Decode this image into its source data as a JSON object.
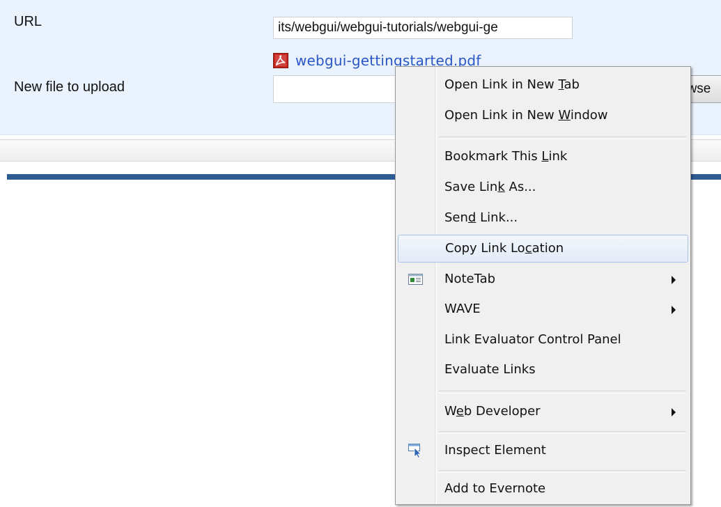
{
  "form": {
    "url_label": "URL",
    "url_value": "its/webgui/webgui-tutorials/webgui-ge",
    "file_link": "webgui-gettingstarted.pdf",
    "upload_label": "New file to upload",
    "browse_fragment": "Browse"
  },
  "menu": {
    "items": [
      {
        "pre": "Open Link in New ",
        "key": "T",
        "post": "ab"
      },
      {
        "pre": "Open Link in New ",
        "key": "W",
        "post": "indow"
      },
      {
        "pre": "Bookmark This ",
        "key": "L",
        "post": "ink"
      },
      {
        "pre": "Save Lin",
        "key": "k",
        "post": " As..."
      },
      {
        "pre": "Sen",
        "key": "d",
        "post": " Link..."
      },
      {
        "pre": "Copy Link Lo",
        "key": "c",
        "post": "ation"
      },
      {
        "label": "NoteTab"
      },
      {
        "label": "WAVE"
      },
      {
        "label": "Link Evaluator Control Panel"
      },
      {
        "label": "Evaluate Links"
      },
      {
        "pre": "W",
        "key": "e",
        "post": "b Developer"
      },
      {
        "label": "Inspect Element"
      },
      {
        "label": "Add to Evernote"
      }
    ]
  },
  "icons": {
    "pdf": "pdf-file-icon",
    "notetab": "notetab-window-icon",
    "inspect": "inspect-element-icon"
  },
  "colors": {
    "link": "#2a57c7",
    "panel_bg": "#eaf2fd",
    "rule": "#2d5b92",
    "menu_bg": "#f0f0f0",
    "highlight_border": "#a9c3e6"
  }
}
